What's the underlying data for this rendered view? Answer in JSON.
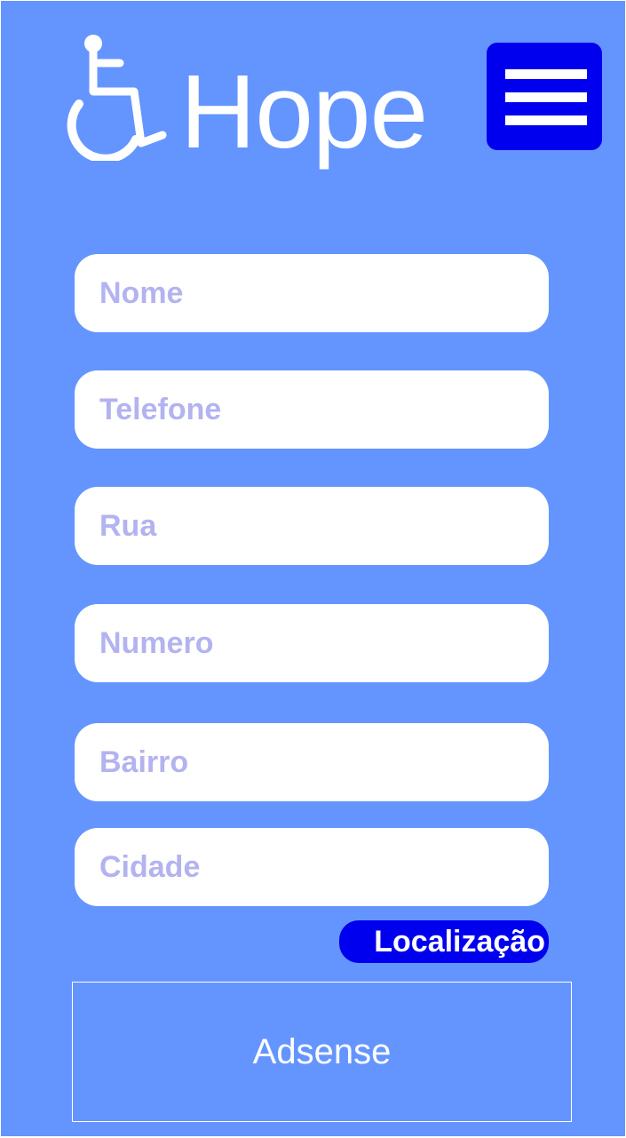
{
  "app": {
    "title": "Hope",
    "logo_icon": "wheelchair-accessibility-icon",
    "menu_icon": "hamburger-menu-icon"
  },
  "form": {
    "fields": [
      {
        "key": "nome",
        "placeholder": "Nome",
        "value": ""
      },
      {
        "key": "telefone",
        "placeholder": "Telefone",
        "value": ""
      },
      {
        "key": "rua",
        "placeholder": "Rua",
        "value": ""
      },
      {
        "key": "numero",
        "placeholder": "Numero",
        "value": ""
      },
      {
        "key": "bairro",
        "placeholder": "Bairro",
        "value": ""
      },
      {
        "key": "cidade",
        "placeholder": "Cidade",
        "value": ""
      }
    ],
    "location_button_label": "Localização"
  },
  "ad": {
    "label": "Adsense"
  },
  "colors": {
    "background": "#6495ff",
    "accent": "#0000ee",
    "field_background": "#ffffff",
    "placeholder": "#b3b3f0",
    "text_on_dark": "#ffffff"
  }
}
